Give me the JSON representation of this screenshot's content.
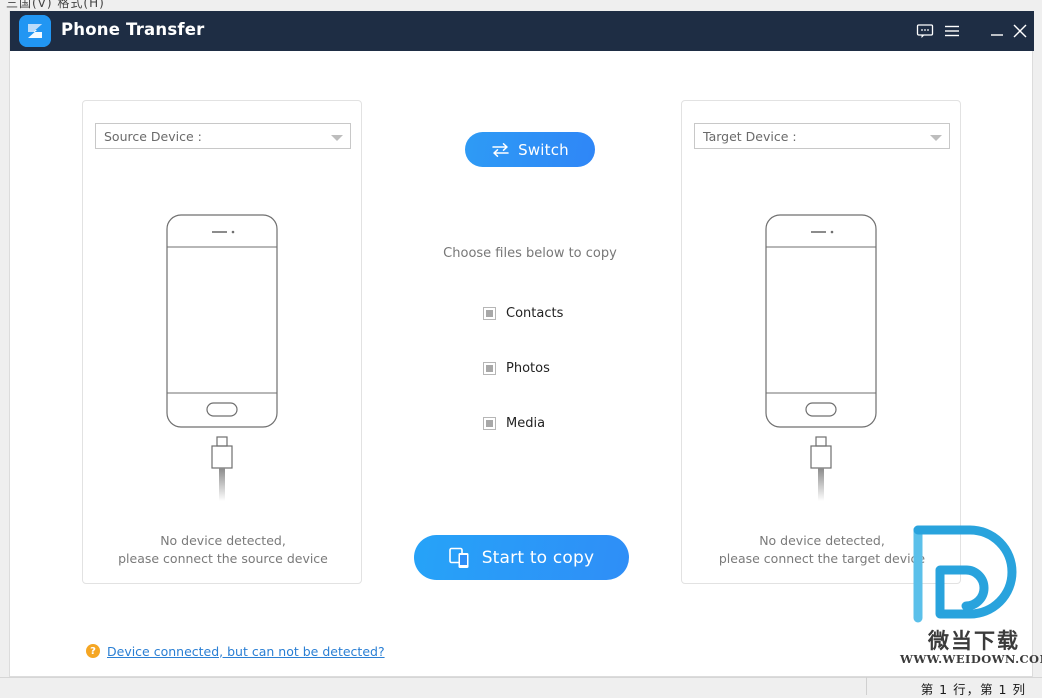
{
  "host": {
    "top_partial_text": "三国(V)   格式(H)",
    "status_text": "第 1 行，第 1 列"
  },
  "titlebar": {
    "app_title": "Phone Transfer",
    "logo_icon": "phone-transfer-logo-icon",
    "controls": [
      {
        "name": "feedback-icon",
        "label": "Feedback"
      },
      {
        "name": "menu-icon",
        "label": "Menu"
      },
      {
        "name": "minimize-icon",
        "label": "Minimize"
      },
      {
        "name": "close-icon",
        "label": "Close"
      }
    ]
  },
  "source_panel": {
    "select_label": "Source Device :",
    "select_arrow_icon": "chevron-down-icon",
    "phone_icon": "phone-with-usb-cable-icon",
    "status_line_1": "No device detected,",
    "status_line_2": "please connect the source device"
  },
  "target_panel": {
    "select_label": "Target Device :",
    "select_arrow_icon": "chevron-down-icon",
    "phone_icon": "phone-with-usb-cable-icon",
    "status_line_1": "No device detected,",
    "status_line_2": "please connect the target device"
  },
  "center": {
    "switch_label": "Switch",
    "switch_icon": "swap-arrows-icon",
    "choose_files_text": "Choose files below to copy",
    "file_options": [
      {
        "label": "Contacts",
        "checked": false,
        "enabled": false
      },
      {
        "label": "Photos",
        "checked": false,
        "enabled": false
      },
      {
        "label": "Media",
        "checked": false,
        "enabled": false
      }
    ],
    "start_copy_label": "Start to copy",
    "start_copy_icon": "two-devices-icon"
  },
  "help": {
    "icon": "question-mark-icon",
    "link_text": "Device connected, but can not be detected?"
  },
  "watermark": {
    "logo_icon": "weidown-d-logo-icon",
    "name_cn": "微当下载",
    "url": "WWW.WEIDOWN.COM"
  },
  "colors": {
    "titlebar": "#1e2d44",
    "accent_blue": "#2f8ef7",
    "link_blue": "#2a7fd4",
    "help_orange": "#f5a623",
    "watermark_blue": "#2ba6e0",
    "panel_border": "#e2e2e2",
    "muted_text": "#7a7a7a"
  }
}
